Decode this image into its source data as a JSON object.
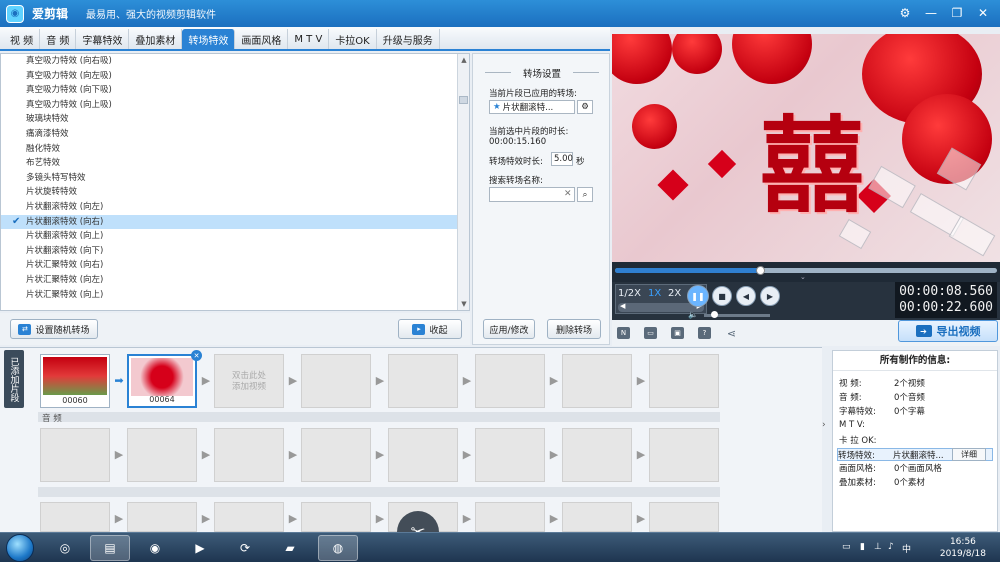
{
  "app": {
    "name": "爱剪辑",
    "slogan": "最易用、强大的视频剪辑软件",
    "window_controls": [
      "⚙",
      "—",
      "❐",
      "✕"
    ]
  },
  "tabs": [
    {
      "label": "视  频",
      "active": false
    },
    {
      "label": "音  频",
      "active": false
    },
    {
      "label": "字幕特效",
      "active": false
    },
    {
      "label": "叠加素材",
      "active": false
    },
    {
      "label": "转场特效",
      "active": true
    },
    {
      "label": "画面风格",
      "active": false
    },
    {
      "label": "M T V",
      "active": false
    },
    {
      "label": "卡拉OK",
      "active": false
    },
    {
      "label": "升级与服务",
      "active": false
    }
  ],
  "effects_list": [
    {
      "label": "真空吸力特效 (向右吸)",
      "selected": false
    },
    {
      "label": "真空吸力特效 (向左吸)",
      "selected": false
    },
    {
      "label": "真空吸力特效 (向下吸)",
      "selected": false
    },
    {
      "label": "真空吸力特效 (向上吸)",
      "selected": false
    },
    {
      "label": "玻璃块特效",
      "selected": false
    },
    {
      "label": "痛滴漆特效",
      "selected": false
    },
    {
      "label": "融化特效",
      "selected": false
    },
    {
      "label": "布艺特效",
      "selected": false
    },
    {
      "label": "多镜头特写特效",
      "selected": false
    },
    {
      "label": "片状旋转特效",
      "selected": false
    },
    {
      "label": "片状翻滚特效 (向左)",
      "selected": false
    },
    {
      "label": "片状翻滚特效 (向右)",
      "selected": true
    },
    {
      "label": "片状翻滚特效 (向上)",
      "selected": false
    },
    {
      "label": "片状翻滚特效 (向下)",
      "selected": false
    },
    {
      "label": "片状汇聚特效 (向右)",
      "selected": false
    },
    {
      "label": "片状汇聚特效 (向左)",
      "selected": false
    },
    {
      "label": "片状汇聚特效 (向上)",
      "selected": false
    }
  ],
  "list_actions": {
    "random_label": "设置随机转场",
    "collapse_label": "收起"
  },
  "settings": {
    "title": "转场设置",
    "applied_label": "当前片段已应用的转场:",
    "applied_value": "片状翻滚特...",
    "selected_duration_label": "当前选中片段的时长:",
    "selected_duration_value": "00:00:15.160",
    "effect_duration_label": "转场特效时长:",
    "effect_duration_value": "5.00",
    "effect_duration_unit": "秒",
    "search_label": "搜索转场名称:",
    "search_value": "",
    "apply_label": "应用/修改",
    "delete_label": "删除转场"
  },
  "player": {
    "progress": 0.38,
    "speeds": [
      "1/2X",
      "1X",
      "2X"
    ],
    "active_speed": "1X",
    "current_time": "00:00:08.560",
    "total_time": "00:00:22.600",
    "volume": 0.15
  },
  "export": {
    "label": "导出视频"
  },
  "timeline": {
    "side_tab": "已添加片段",
    "clips": [
      {
        "name": "00060",
        "selected": false
      },
      {
        "name": "00064",
        "selected": true
      }
    ],
    "placeholder_text": "双击此处\n添加视频",
    "audio_label": "音 频"
  },
  "info": {
    "title": "所有制作的信息:",
    "rows": [
      {
        "key": "视    频:",
        "value": "2个视频"
      },
      {
        "key": "音    频:",
        "value": "0个音频"
      },
      {
        "key": "字幕特效:",
        "value": "0个字幕"
      },
      {
        "key": "M  T  V:",
        "value": ""
      },
      {
        "key": "卡 拉 OK:",
        "value": ""
      },
      {
        "key": "转场特效:",
        "value": "片状翻滚特...",
        "detail": "详细"
      },
      {
        "key": "画面风格:",
        "value": "0个画面风格"
      },
      {
        "key": "叠加素材:",
        "value": "0个素材"
      }
    ]
  },
  "taskbar": {
    "time": "16:56",
    "date": "2019/8/18"
  },
  "colors": {
    "accent": "#2a82d4",
    "title_bar": "#1b6fbf",
    "selection": "#bfe0fb",
    "player_bg": "#27323e"
  }
}
